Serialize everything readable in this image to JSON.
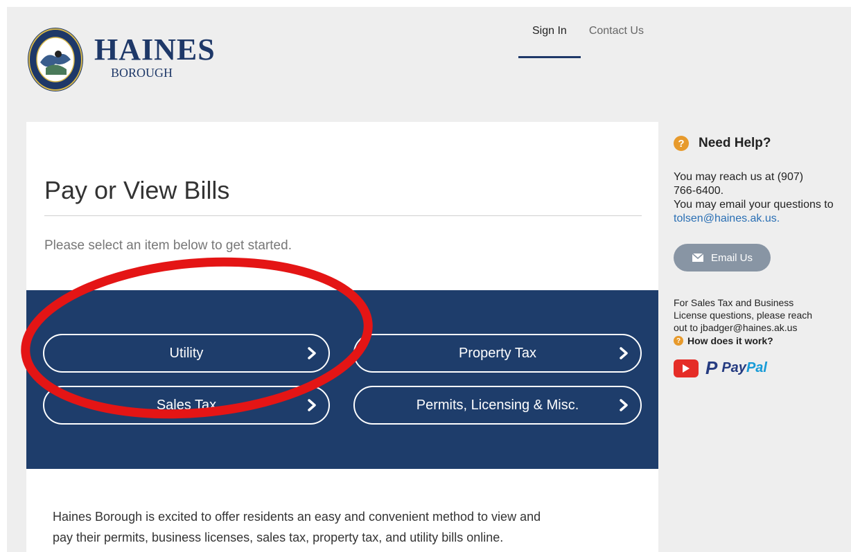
{
  "header": {
    "logo_title": "HAINES",
    "logo_subtitle": "BOROUGH",
    "seal_text_top": "HAINES BOROUGH",
    "seal_text_bottom": "ALASKA",
    "nav": {
      "sign_in": "Sign In",
      "contact_us": "Contact Us"
    }
  },
  "main": {
    "title": "Pay or View Bills",
    "subtitle": "Please select an item below to get started.",
    "options": {
      "utility": "Utility",
      "property_tax": "Property Tax",
      "sales_tax": "Sales Tax",
      "permits": "Permits, Licensing & Misc."
    },
    "intro_line1": "Haines Borough is excited to offer residents an easy and convenient method to view and",
    "intro_line2": "pay their permits, business licenses, sales tax, property tax, and utility bills online."
  },
  "help": {
    "heading": "Need Help?",
    "line1": "You may reach us at (907)",
    "line2": "766-6400.",
    "line3": "You may email your questions to",
    "email_link": "tolsen@haines.ak.us.",
    "email_button": "Email Us",
    "sales_line1": "For Sales Tax and Business",
    "sales_line2": "License questions, please reach",
    "sales_line3": "out to jbadger@haines.ak.us",
    "how_link": "How does it work?",
    "paypal_pay": "Pay",
    "paypal_pal": "Pal"
  },
  "colors": {
    "brand_navy": "#1e3d6b",
    "accent_orange": "#e79a2c",
    "annotation_red": "#e41515",
    "link_blue": "#2a6fb4"
  },
  "icons": [
    "seal-logo",
    "chevron-right-icon",
    "question-circle-icon",
    "envelope-icon",
    "youtube-icon",
    "paypal-logo"
  ]
}
